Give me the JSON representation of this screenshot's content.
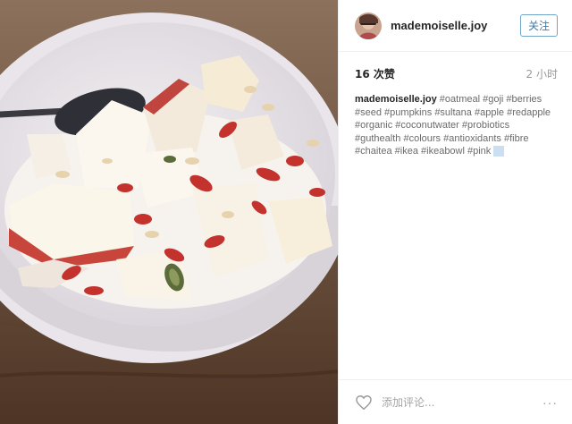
{
  "post": {
    "username": "mademoiselle.joy",
    "follow_label": "关注",
    "likes": "16 次赞",
    "time_ago": "2 小时",
    "caption_user": "mademoiselle.joy",
    "hashtags": [
      "#oatmeal",
      "#goji",
      "#berries",
      "#seed",
      "#pumpkins",
      "#sultana",
      "#apple",
      "#redapple",
      "#organic",
      "#coconutwater",
      "#probiotics",
      "#guthealth",
      "#colours",
      "#antioxidants",
      "#fibre",
      "#chaitea",
      "#ikea",
      "#ikeabowl",
      "#pink"
    ],
    "comment_placeholder": "添加评论...",
    "more_label": "···"
  },
  "colors": {
    "link": "#3d78a8",
    "text": "#262626",
    "muted": "#999999",
    "selection": "#cbdff0"
  },
  "icons": {
    "avatar": "avatar",
    "like": "heart-icon",
    "more": "more-options-icon"
  }
}
